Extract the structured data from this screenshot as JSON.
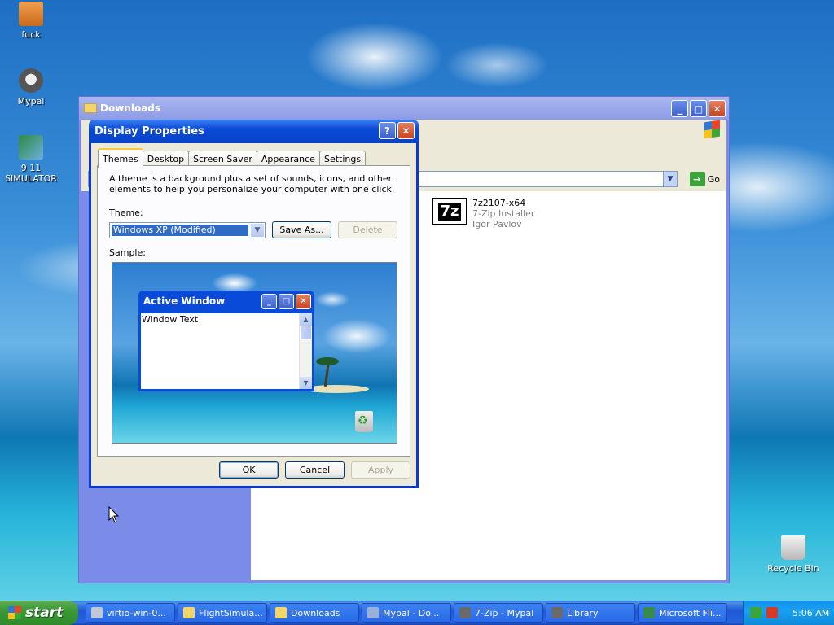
{
  "desktop": {
    "icons": [
      {
        "label": "fuck",
        "icon": "briefcase-folder-icon",
        "color": "#e07a2a"
      },
      {
        "label": "Mypal",
        "icon": "raccoon-icon",
        "color": "#5a5a5a"
      },
      {
        "label": "9 11 SIMULATOR",
        "icon": "airplane-icon",
        "color": "#2a7a3a"
      },
      {
        "label": "Recycle Bin",
        "icon": "recycle-bin-icon",
        "color": "#cfcfcf"
      }
    ]
  },
  "downloads_window": {
    "title": "Downloads",
    "go_label": "Go",
    "file": {
      "name": "7z2107-x64",
      "description": "7-Zip Installer",
      "company": "Igor Pavlov",
      "icon_text": "7z"
    }
  },
  "dialog": {
    "title": "Display Properties",
    "tabs": [
      "Themes",
      "Desktop",
      "Screen Saver",
      "Appearance",
      "Settings"
    ],
    "active_tab": "Themes",
    "description": "A theme is a background plus a set of sounds, icons, and other elements to help you personalize your computer with one click.",
    "theme_label": "Theme:",
    "theme_value": "Windows XP (Modified)",
    "save_as_label": "Save As...",
    "delete_label": "Delete",
    "sample_label": "Sample:",
    "sample_window_title": "Active Window",
    "sample_window_text": "Window Text",
    "ok_label": "OK",
    "cancel_label": "Cancel",
    "apply_label": "Apply"
  },
  "taskbar": {
    "start_label": "start",
    "tasks": [
      {
        "label": "virtio-win-0...",
        "icon": "installer-icon",
        "color": "#c0c8d8"
      },
      {
        "label": "FlightSimula...",
        "icon": "folder-icon",
        "color": "#f3d56a"
      },
      {
        "label": "Downloads",
        "icon": "folder-icon",
        "color": "#f3d56a"
      },
      {
        "label": "Mypal - Do...",
        "icon": "mypal-icon",
        "color": "#9ab0d8"
      },
      {
        "label": "7-Zip - Mypal",
        "icon": "raccoon-icon",
        "color": "#6a6a6a"
      },
      {
        "label": "Library",
        "icon": "raccoon-icon",
        "color": "#6a6a6a"
      },
      {
        "label": "Microsoft Fli...",
        "icon": "airplane-icon",
        "color": "#3a8a4a"
      }
    ],
    "tray": {
      "clock": "5:06 AM",
      "icons": [
        "network-icon",
        "security-shield-icon"
      ]
    }
  }
}
